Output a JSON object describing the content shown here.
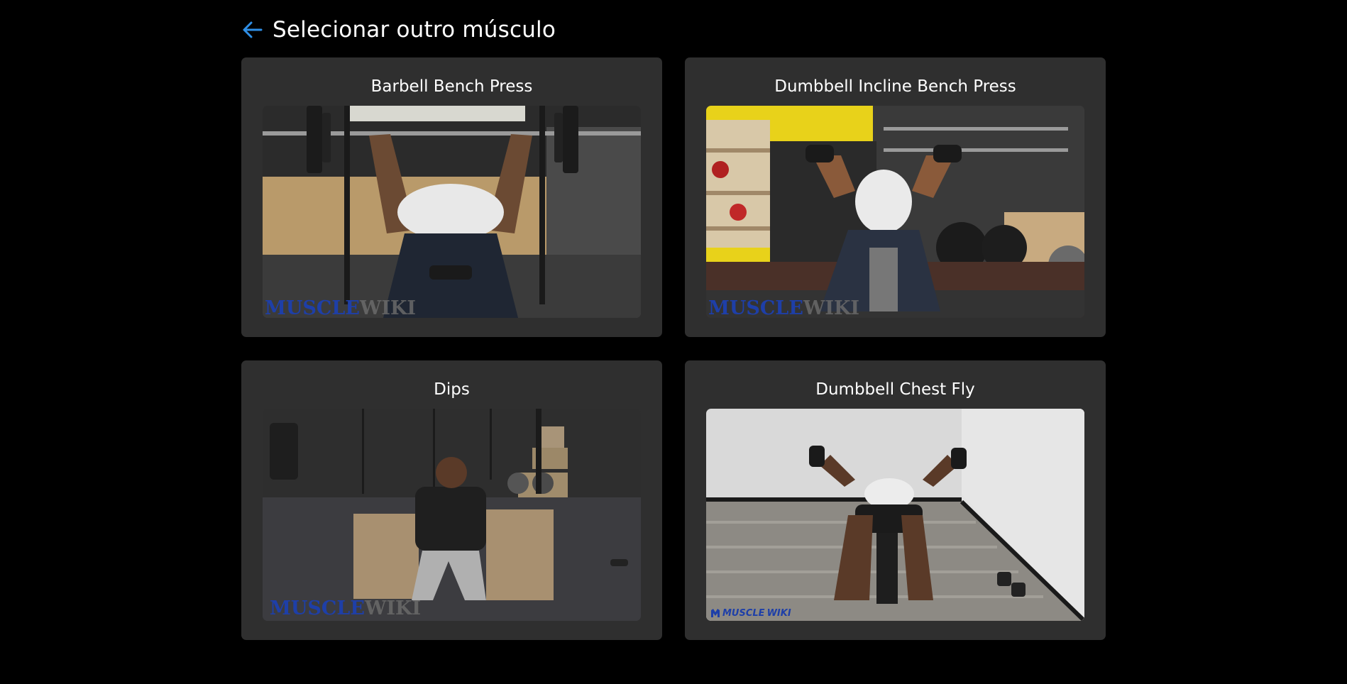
{
  "header": {
    "back_label": "Selecionar outro músculo"
  },
  "exercises": [
    {
      "title": "Barbell Bench Press",
      "watermark_a": "MUSCLE",
      "watermark_b": "WIKI"
    },
    {
      "title": "Dumbbell Incline Bench Press",
      "watermark_a": "MUSCLE",
      "watermark_b": "WIKI"
    },
    {
      "title": "Dips",
      "watermark_a": "MUSCLE",
      "watermark_b": "WIKI"
    },
    {
      "title": "Dumbbell Chest Fly",
      "watermark_a": "MUSCLE",
      "watermark_b": "WIKI"
    }
  ],
  "colors": {
    "background": "#000000",
    "card": "#2f2f2f",
    "accent": "#2f8fe6",
    "watermark": "#1e3fa8"
  }
}
